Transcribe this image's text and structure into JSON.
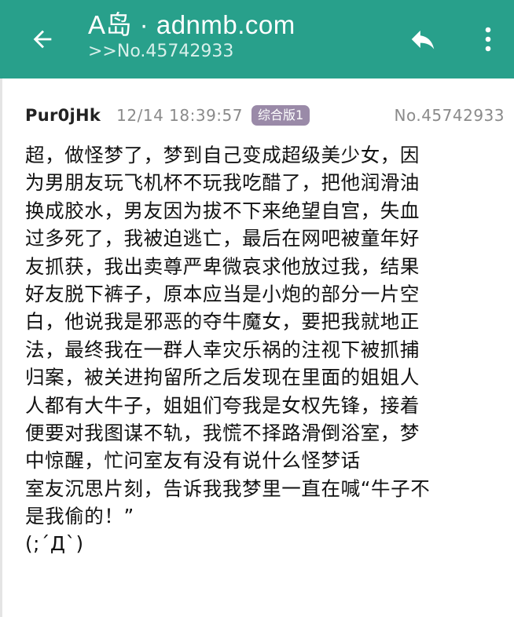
{
  "appbar": {
    "title": "A岛 · adnmb.com",
    "subtitle": ">>No.45742933",
    "background_color": "#28a08b",
    "back_icon": "arrow-left-icon",
    "reply_icon": "reply-icon",
    "more_icon": "more-vertical-icon"
  },
  "post": {
    "uid": "Pur0jHk",
    "time": "12/14 18:39:57",
    "board": "综合版1",
    "number": "No.45742933",
    "content_lines": [
      "超，做怪梦了，梦到自己变成超级美少女，因",
      "为男朋友玩飞机杯不玩我吃醋了，把他润滑油",
      "换成胶水，男友因为拔不下来绝望自宫，失血",
      "过多死了，我被迫逃亡，最后在网吧被童年好",
      "友抓获，我出卖尊严卑微哀求他放过我，结果",
      "好友脱下裤子，原本应当是小炮的部分一片空",
      "白，他说我是邪恶的夺牛魔女，要把我就地正",
      "法，最终我在一群人幸灾乐祸的注视下被抓捕",
      "归案，被关进拘留所之后发现在里面的姐姐人",
      "人都有大牛子，姐姐们夸我是女权先锋，接着",
      "便要对我图谋不轨，我慌不择路滑倒浴室，梦",
      "中惊醒，忙问室友有没有说什么怪梦话",
      "室友沉思片刻，告诉我我梦里一直在喊“牛子不",
      "是我偷的！”",
      "(;´Д`)"
    ]
  }
}
